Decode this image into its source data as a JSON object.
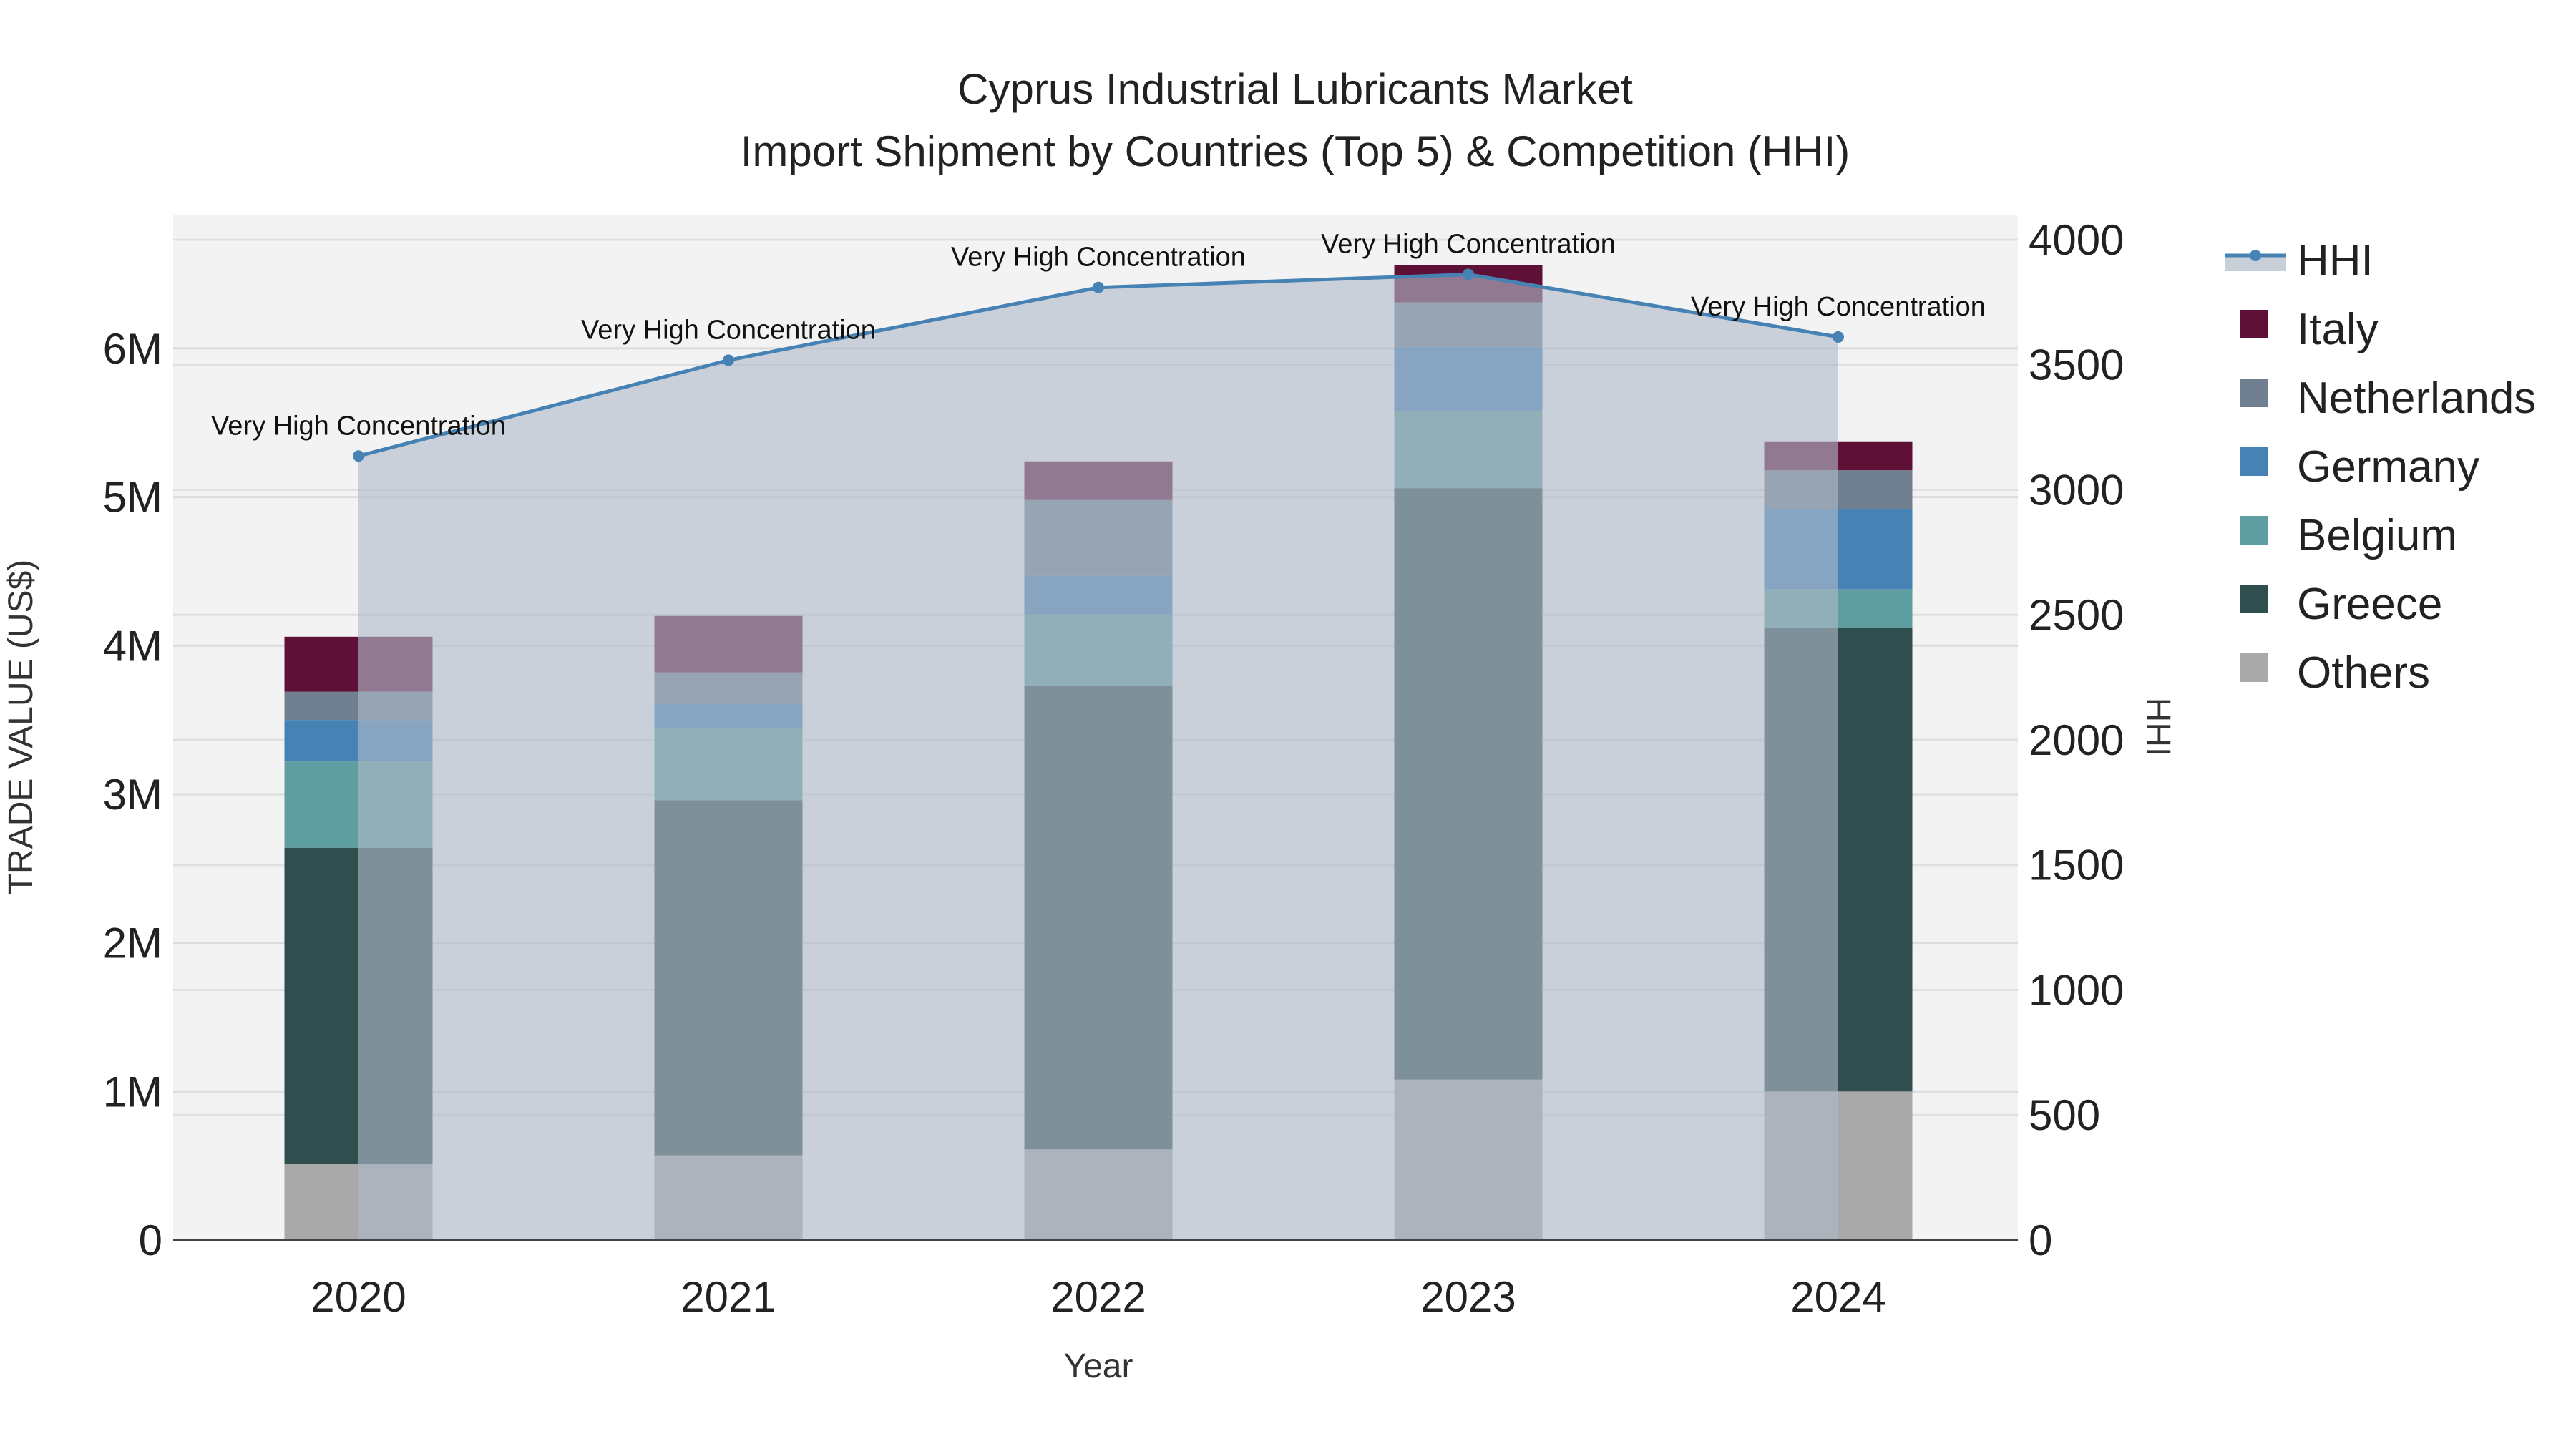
{
  "chart_data": {
    "type": "bar",
    "title": "Cyprus Industrial Lubricants Market",
    "subtitle": "Import Shipment by Countries (Top 5) & Competition (HHI)",
    "xlabel": "Year",
    "ylabel": "TRADE VALUE (US$)",
    "y2label": "HHI",
    "categories": [
      "2020",
      "2021",
      "2022",
      "2023",
      "2024"
    ],
    "ylim": [
      0,
      6900000
    ],
    "y2lim": [
      0,
      4100
    ],
    "yticks": [
      {
        "v": 0,
        "label": "0"
      },
      {
        "v": 1000000,
        "label": "1M"
      },
      {
        "v": 2000000,
        "label": "2M"
      },
      {
        "v": 3000000,
        "label": "3M"
      },
      {
        "v": 4000000,
        "label": "4M"
      },
      {
        "v": 5000000,
        "label": "5M"
      },
      {
        "v": 6000000,
        "label": "6M"
      }
    ],
    "y2ticks": [
      0,
      500,
      1000,
      1500,
      2000,
      2500,
      3000,
      3500,
      4000
    ],
    "series": [
      {
        "name": "Others",
        "color": "#a9a9a9",
        "values": [
          510000,
          570000,
          610000,
          1080000,
          1000000
        ]
      },
      {
        "name": "Greece",
        "color": "#2f4f4f",
        "values": [
          2130000,
          2390000,
          3120000,
          3980000,
          3120000
        ]
      },
      {
        "name": "Belgium",
        "color": "#5f9ea0",
        "values": [
          580000,
          480000,
          480000,
          520000,
          260000
        ]
      },
      {
        "name": "Germany",
        "color": "#4682b4",
        "values": [
          280000,
          170000,
          260000,
          430000,
          540000
        ]
      },
      {
        "name": "Netherlands",
        "color": "#708090",
        "values": [
          190000,
          210000,
          510000,
          300000,
          260000
        ]
      },
      {
        "name": "Italy",
        "color": "#5f1037",
        "values": [
          370000,
          380000,
          260000,
          250000,
          190000
        ]
      }
    ],
    "hhi": {
      "name": "HHI",
      "color": "#4682b4",
      "values": [
        3135,
        3518,
        3809,
        3861,
        3611
      ],
      "annotations": [
        "Very High Concentration",
        "Very High Concentration",
        "Very High Concentration",
        "Very High Concentration",
        "Very High Concentration"
      ]
    },
    "legend_order": [
      "HHI",
      "Italy",
      "Netherlands",
      "Germany",
      "Belgium",
      "Greece",
      "Others"
    ],
    "legend_position": "right"
  }
}
